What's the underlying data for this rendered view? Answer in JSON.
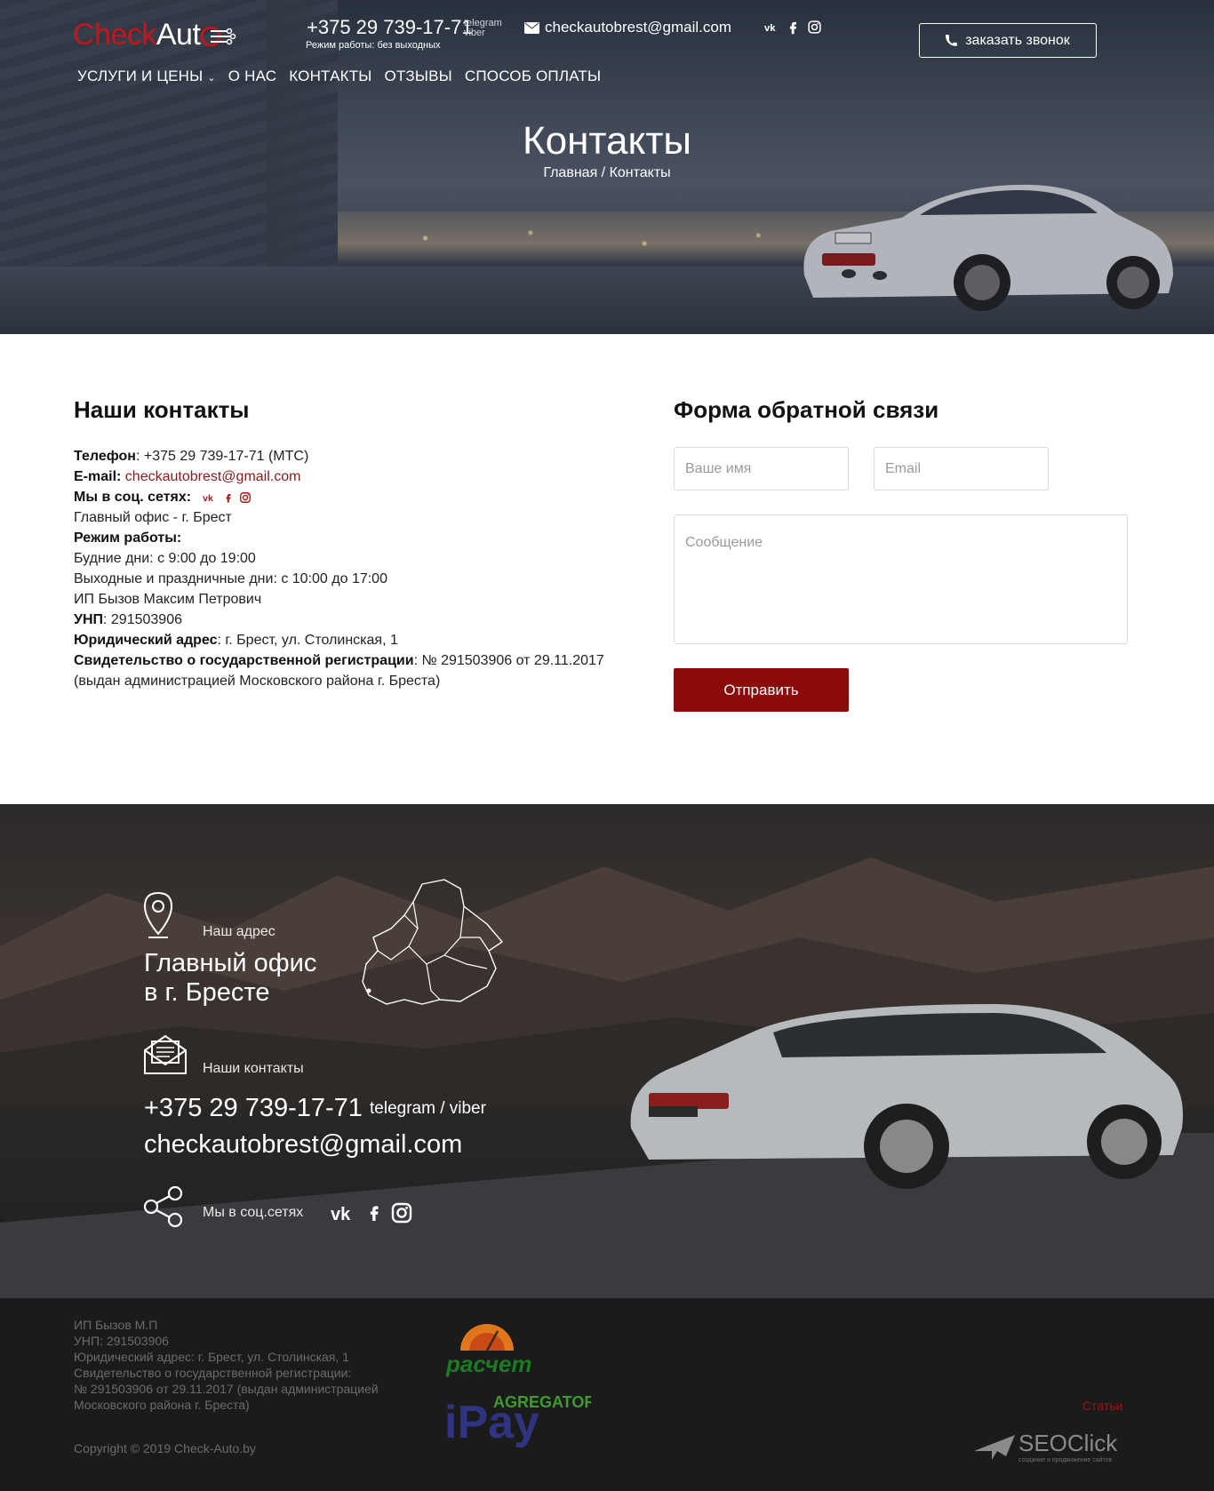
{
  "header": {
    "logo_part1": "Check",
    "logo_part2": "Aut",
    "phone": "+375 29 739-17-71",
    "phone_tag1": "telegram",
    "phone_tag2": "viber",
    "hours": "Режим работы: без выходных",
    "email": "checkautobrest@gmail.com",
    "call_button": "заказать звонок",
    "nav": [
      "УСЛУГИ И ЦЕНЫ",
      "О НАС",
      "КОНТАКТЫ",
      "ОТЗЫВЫ",
      "СПОСОБ ОПЛАТЫ"
    ],
    "title": "Контакты",
    "breadcrumb": "Главная / Контакты"
  },
  "contacts": {
    "heading": "Наши контакты",
    "phone_label": "Телефон",
    "phone_value": ": +375 29 739-17-71 (МТС)",
    "email_label": "E-mail:",
    "email_value": "checkautobrest@gmail.com",
    "social_label": "Мы в соц. сетях:",
    "office": "Главный офис - г. Брест",
    "hours_label": "Режим работы:",
    "weekdays": "Будние дни: с 9:00 до 19:00",
    "weekends": "Выходные и праздничные дни: с 10:00 до 17:00",
    "owner": "ИП Бызов Максим Петрович",
    "unp_label": "УНП",
    "unp_value": ": 291503906",
    "address_label": "Юридический адрес",
    "address_value": ": г. Брест, ул. Столинская, 1",
    "cert_label": "Свидетельство о государственной регистрации",
    "cert_value": ": № 291503906 от 29.11.2017 (выдан администрацией Московского района г. Бреста)"
  },
  "form": {
    "heading": "Форма обратной связи",
    "name_placeholder": "Ваше имя",
    "email_placeholder": "Email",
    "message_placeholder": "Сообщение",
    "submit": "Отправить"
  },
  "band": {
    "address_label": "Наш адрес",
    "address_line1": "Главный офис",
    "address_line2": "в г. Бресте",
    "contacts_label": "Наши контакты",
    "phone": "+375 29 739-17-71",
    "phone_tag": "telegram / viber",
    "email": "checkautobrest@gmail.com",
    "social_label": "Мы в соц.сетях"
  },
  "footer": {
    "legal": [
      "ИП Бызов М.П",
      "УНП: 291503906",
      "Юридический адрес: г. Брест, ул. Столинская, 1",
      "Свидетельство о государственной регистрации:",
      "№ 291503906 от 29.11.2017 (выдан администрацией",
      "Московского района г. Бреста)"
    ],
    "copyright": "Copyright © 2019 Check-Auto.by",
    "articles_link": "Статьи",
    "raschet_logo_text": "расчет",
    "ipay_logo_text": "iPay",
    "ipay_agregator_text": "AGREGATOR",
    "seoclick_text": "SEOClick",
    "seoclick_tagline": "создание и продвижение сайтов"
  },
  "colors": {
    "brand_red": "#c3161c",
    "button_red": "#8b0a0a",
    "link_red": "#8b1a1a"
  }
}
